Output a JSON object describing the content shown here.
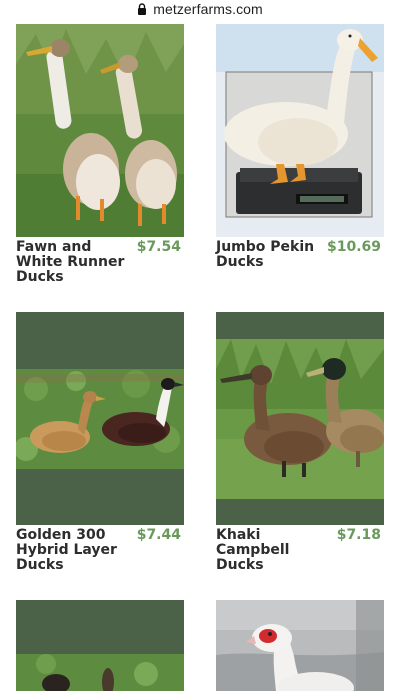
{
  "browser": {
    "url": "metzerfarms.com"
  },
  "colors": {
    "price": "#6a9a5b",
    "band": "#4b6249",
    "title": "#2d2d2d"
  },
  "products": [
    {
      "name": "Fawn and White Runner Ducks",
      "price": "$7.54"
    },
    {
      "name": "Jumbo Pekin Ducks",
      "price": "$10.69"
    },
    {
      "name": "Golden 300 Hybrid Layer Ducks",
      "price": "$7.44"
    },
    {
      "name": "Khaki Campbell Ducks",
      "price": "$7.18"
    },
    {
      "name": "",
      "price": ""
    },
    {
      "name": "",
      "price": ""
    }
  ]
}
